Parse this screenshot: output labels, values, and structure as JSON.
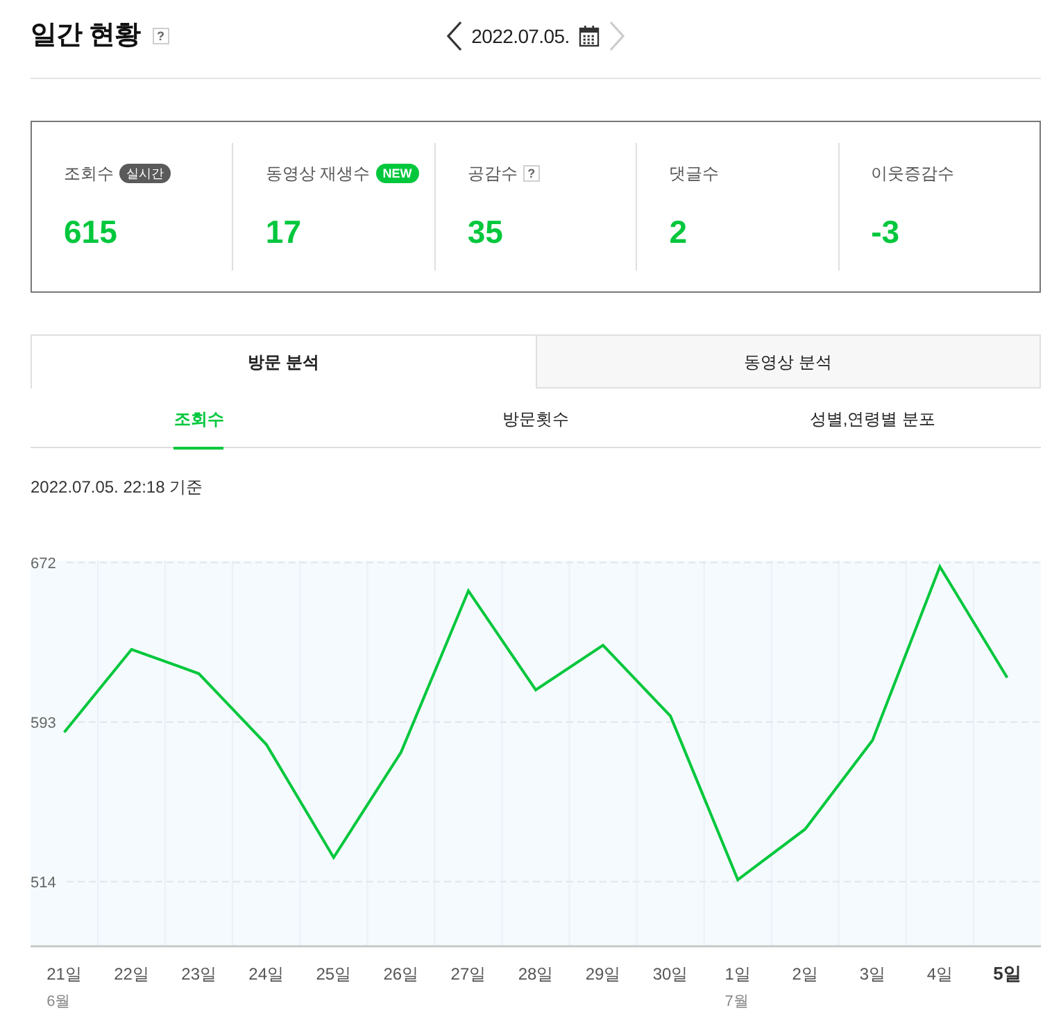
{
  "header": {
    "title": "일간 현황",
    "help": "?",
    "date_nav": {
      "date": "2022.07.05.",
      "prev_disabled": false,
      "next_disabled": true
    }
  },
  "stats": [
    {
      "label": "조회수",
      "badge": {
        "kind": "realtime",
        "text": "실시간"
      },
      "value": "615"
    },
    {
      "label": "동영상 재생수",
      "badge": {
        "kind": "new",
        "text": "NEW"
      },
      "value": "17"
    },
    {
      "label": "공감수",
      "help": "?",
      "value": "35"
    },
    {
      "label": "댓글수",
      "value": "2"
    },
    {
      "label": "이웃증감수",
      "value": "-3"
    }
  ],
  "tabs": [
    {
      "label": "방문 분석",
      "selected": true
    },
    {
      "label": "동영상 분석",
      "selected": false
    }
  ],
  "subtabs": [
    {
      "label": "조회수",
      "selected": true
    },
    {
      "label": "방문횟수",
      "selected": false
    },
    {
      "label": "성별,연령별 분포",
      "selected": false
    }
  ],
  "as_of": "2022.07.05. 22:18 기준",
  "chart": {
    "chart_data": {
      "type": "line",
      "categories": [
        "21일",
        "22일",
        "23일",
        "24일",
        "25일",
        "26일",
        "27일",
        "28일",
        "29일",
        "30일",
        "1일",
        "2일",
        "3일",
        "4일",
        "5일"
      ],
      "ylim": [
        482,
        673
      ],
      "yticks": [
        514,
        593,
        672
      ],
      "series": [
        {
          "color": "#00c73c",
          "values": [
            588,
            629,
            617,
            582,
            526,
            578,
            658,
            609,
            631,
            596,
            515,
            540,
            584,
            670,
            615
          ]
        }
      ]
    },
    "x_axis_marks": [
      {
        "month": "6월",
        "selected": false
      },
      {
        "selected": false
      },
      {
        "selected": false
      },
      {
        "selected": false
      },
      {
        "selected": false
      },
      {
        "selected": false
      },
      {
        "selected": false
      },
      {
        "selected": false
      },
      {
        "selected": false
      },
      {
        "selected": false
      },
      {
        "month": "7월",
        "selected": false
      },
      {
        "selected": false
      },
      {
        "selected": false
      },
      {
        "selected": false
      },
      {
        "selected": true
      }
    ]
  }
}
